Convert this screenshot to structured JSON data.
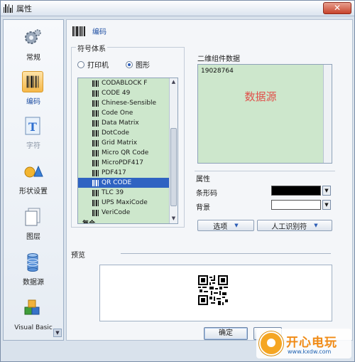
{
  "window": {
    "title": "属性",
    "close_symbol": "✕"
  },
  "sidebar": {
    "items": [
      {
        "label": "常规",
        "icon": "gear-icon"
      },
      {
        "label": "编码",
        "icon": "barcode-icon"
      },
      {
        "label": "字符",
        "icon": "text-icon"
      },
      {
        "label": "形状设置",
        "icon": "shapes-icon"
      },
      {
        "label": "图层",
        "icon": "layer-icon"
      },
      {
        "label": "数据源",
        "icon": "database-icon"
      },
      {
        "label": "Visual Basic",
        "icon": "vb-blocks-icon"
      }
    ],
    "active_index": 1
  },
  "header": {
    "label": "编码"
  },
  "symbology": {
    "group_title": "符号体系",
    "radio_printer": "打印机",
    "radio_graphic": "图形",
    "selected_radio": "图形",
    "items": [
      "CODABLOCK F",
      "CODE 49",
      "Chinese-Sensible",
      "Code One",
      "Data Matrix",
      "DotCode",
      "Grid Matrix",
      "Micro QR Code",
      "MicroPDF417",
      "PDF417",
      "QR CODE",
      "TLC 39",
      "UPS MaxiCode",
      "VeriCode",
      "复合"
    ],
    "selected_item": "QR CODE"
  },
  "data_panel": {
    "label": "二维组件数据",
    "value": "19028764",
    "hint": "数据源"
  },
  "properties": {
    "group_title": "属性",
    "barcode_label": "条形码",
    "barcode_color": "#000000",
    "background_label": "背景",
    "background_color": "#ffffff",
    "options_button": "选项",
    "human_readable_button": "人工识别符"
  },
  "preview": {
    "label": "预览"
  },
  "footer": {
    "ok_label": "确定"
  },
  "watermark": {
    "text": "开心电玩",
    "sub": "www.kxdw.com"
  }
}
